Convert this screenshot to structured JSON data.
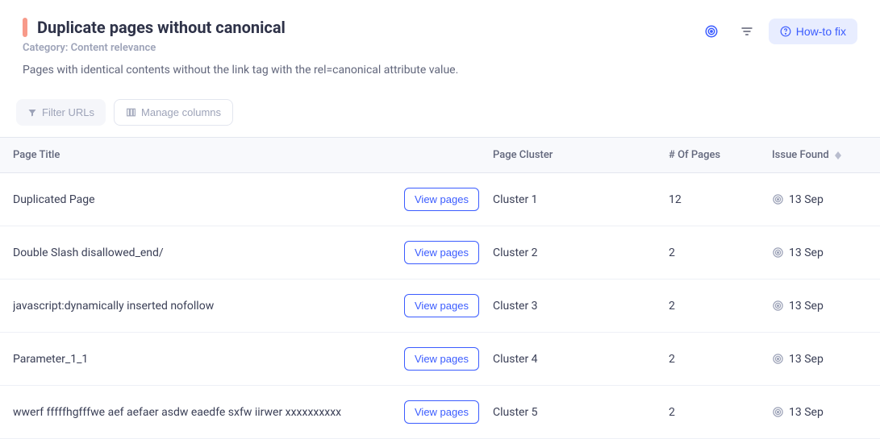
{
  "header": {
    "title": "Duplicate pages without canonical",
    "category_label": "Category: Content relevance",
    "description": "Pages with identical contents without the link tag with the rel=canonical attribute value.",
    "howto_label": "How-to fix"
  },
  "toolbar": {
    "filter_label": "Filter URLs",
    "columns_label": "Manage columns"
  },
  "table": {
    "headers": {
      "page_title": "Page Title",
      "page_cluster": "Page Cluster",
      "num_pages": "# Of Pages",
      "issue_found": "Issue Found"
    },
    "view_pages_label": "View pages",
    "rows": [
      {
        "title": "Duplicated Page",
        "cluster": "Cluster 1",
        "pages": "12",
        "date": "13 Sep"
      },
      {
        "title": "Double Slash disallowed_end/",
        "cluster": "Cluster 2",
        "pages": "2",
        "date": "13 Sep"
      },
      {
        "title": "javascript:dynamically inserted nofollow",
        "cluster": "Cluster 3",
        "pages": "2",
        "date": "13 Sep"
      },
      {
        "title": "Parameter_1_1",
        "cluster": "Cluster 4",
        "pages": "2",
        "date": "13 Sep"
      },
      {
        "title": "wwerf fffffhgfffwe aef aefaer asdw eaedfe sxfw iirwer xxxxxxxxxx",
        "cluster": "Cluster 5",
        "pages": "2",
        "date": "13 Sep"
      }
    ]
  }
}
